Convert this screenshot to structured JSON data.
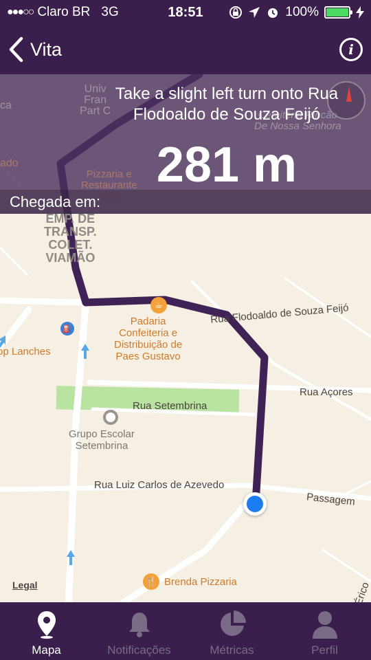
{
  "status_bar": {
    "signal": "●●●○○",
    "carrier": "Claro BR",
    "network": "3G",
    "time": "18:51",
    "battery": "100%",
    "battery_level": 1.0
  },
  "nav": {
    "back_label": "Vita",
    "info_icon": "info-icon"
  },
  "direction": {
    "instruction": "Take a slight left turn onto Rua Flodoaldo de Souza Feijó",
    "distance": "281 m",
    "arrival_label": "Chegada em:"
  },
  "map": {
    "labels": {
      "padaria": "Padaria\nConfeiteria e\nDistribuição de\nPaes Gustavo",
      "grupo_escolar": "Grupo Escolar\nSetembrina",
      "emp_transp": "EMP. DE\nTRANSP.\nCOLET.\nVIAMÃO",
      "lanches": "op Lanches",
      "brenda": "Brenda Pizzaria",
      "rua_flodoaldo": "Rua Flodoaldo de Souza Feijó",
      "rua_acores": "Rua Açores",
      "rua_setembrina": "Rua Setembrina",
      "rua_luiz": "Rua Luiz Carlos de Azevedo",
      "passagem": "Passagem",
      "erico": "Érico",
      "univ": "Univ\nFran\nPart C",
      "pizzaria_rest": "Pizzaria e\nRestaurante\nSola",
      "cemiterio": "Cemitério Rincão\nDe Nossa Senhora",
      "ca": "ca",
      "ado": "ado"
    },
    "legal": "Legal",
    "colors": {
      "route": "#3f2356",
      "park": "#b8e3a0",
      "road": "#ffffff",
      "location": "#1e7cf2"
    }
  },
  "tabs": [
    {
      "label": "Mapa",
      "icon": "map-pin-icon",
      "active": true
    },
    {
      "label": "Notificações",
      "icon": "bell-icon",
      "active": false
    },
    {
      "label": "Métricas",
      "icon": "pie-chart-icon",
      "active": false
    },
    {
      "label": "Perfil",
      "icon": "person-icon",
      "active": false
    }
  ]
}
